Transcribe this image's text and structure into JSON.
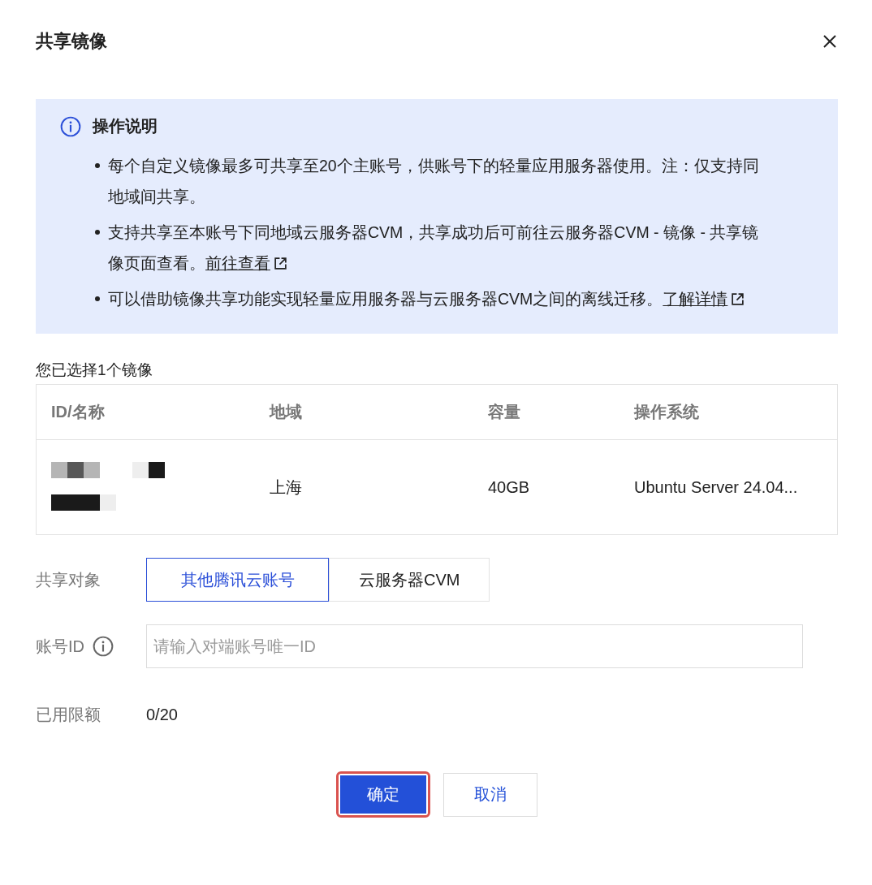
{
  "dialog": {
    "title": "共享镜像"
  },
  "notice": {
    "title": "操作说明",
    "items": [
      {
        "text": "每个自定义镜像最多可共享至20个主账号，供账号下的轻量应用服务器使用。注：仅支持同地域间共享。"
      },
      {
        "text": "支持共享至本账号下同地域云服务器CVM，共享成功后可前往云服务器CVM - 镜像 - 共享镜像页面查看。",
        "link": "前往查看"
      },
      {
        "text": "可以借助镜像共享功能实现轻量应用服务器与云服务器CVM之间的离线迁移。",
        "link": "了解详情"
      }
    ]
  },
  "selection_label": "您已选择1个镜像",
  "table": {
    "columns": [
      "ID/名称",
      "地域",
      "容量",
      "操作系统"
    ],
    "rows": [
      {
        "region": "上海",
        "capacity": "40GB",
        "os": "Ubuntu Server 24.04..."
      }
    ]
  },
  "share_target": {
    "label": "共享对象",
    "options": [
      {
        "label": "其他腾讯云账号",
        "selected": true
      },
      {
        "label": "云服务器CVM",
        "selected": false
      }
    ]
  },
  "account_id": {
    "label": "账号ID",
    "placeholder": "请输入对端账号唯一ID"
  },
  "quota": {
    "label": "已用限额",
    "value": "0/20"
  },
  "buttons": {
    "confirm": "确定",
    "cancel": "取消"
  }
}
